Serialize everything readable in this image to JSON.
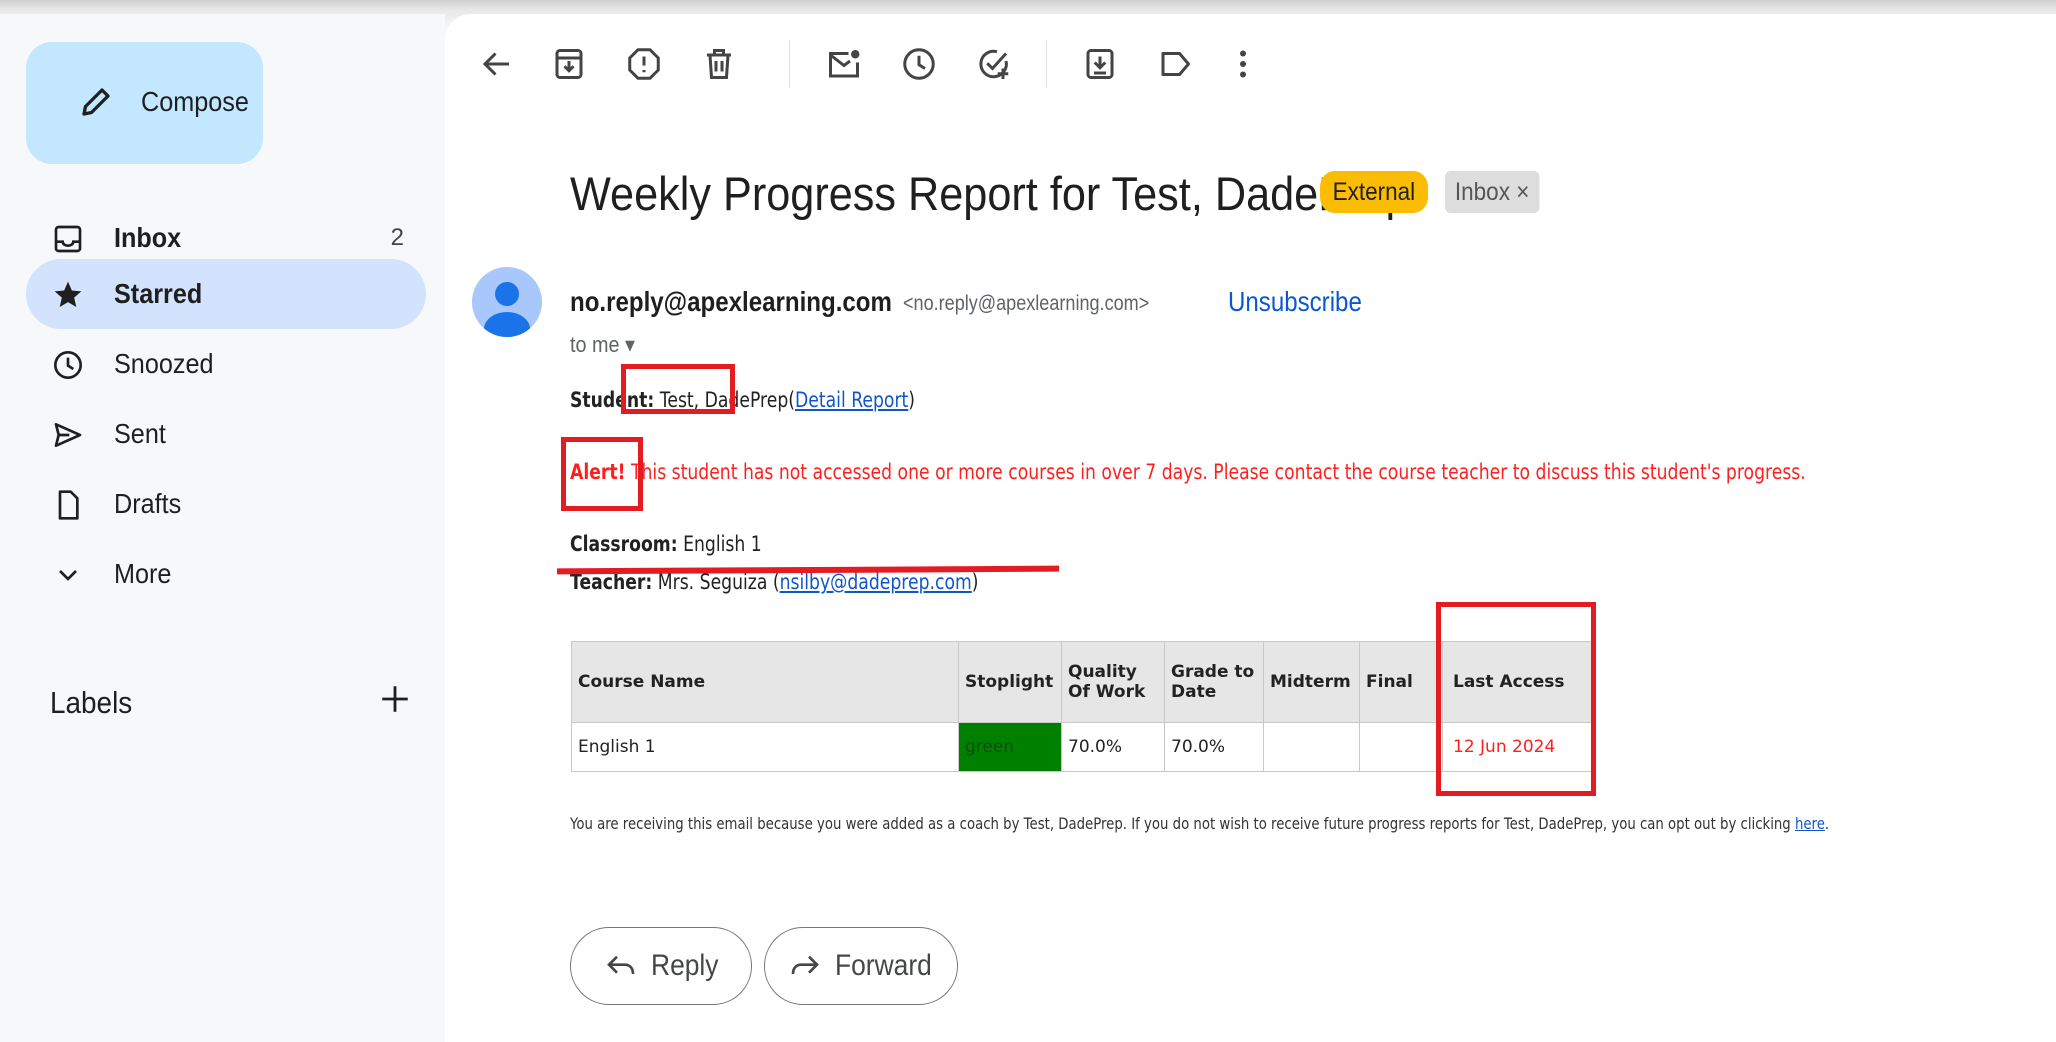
{
  "compose": {
    "label": "Compose"
  },
  "nav": [
    {
      "label": "Inbox",
      "count": "2",
      "icon": "inbox-icon"
    },
    {
      "label": "Starred",
      "count": "",
      "icon": "star-icon"
    },
    {
      "label": "Snoozed",
      "count": "",
      "icon": "clock-icon"
    },
    {
      "label": "Sent",
      "count": "",
      "icon": "send-icon"
    },
    {
      "label": "Drafts",
      "count": "",
      "icon": "draft-icon"
    },
    {
      "label": "More",
      "count": "",
      "icon": "chevron-down-icon"
    }
  ],
  "labels": {
    "header": "Labels"
  },
  "toolbar": {
    "icons": [
      "back-arrow-icon",
      "archive-icon",
      "report-spam-icon",
      "delete-icon",
      "mark-unread-icon",
      "snooze-icon",
      "add-to-tasks-icon",
      "move-to-icon",
      "label-icon",
      "more-vert-icon"
    ]
  },
  "email": {
    "subject": "Weekly Progress Report for Test, DadePrep",
    "badge_external": "External",
    "badge_inbox": "Inbox ×",
    "sender_name": "no.reply@apexlearning.com",
    "sender_email": "<no.reply@apexlearning.com>",
    "unsubscribe": "Unsubscribe",
    "to": "to me ▾",
    "student_label": "Student:",
    "student_value": "Test, DadePrep",
    "detail_open": "(",
    "detail_link": "Detail Report",
    "detail_close": ")",
    "alert_label": "Alert!",
    "alert_text": "This student has not accessed one or more courses in over 7 days. Please contact the course teacher to discuss this student's progress.",
    "classroom_label": "Classroom:",
    "classroom_value": "English 1",
    "teacher_label": "Teacher:",
    "teacher_value": "Mrs. Seguiza (",
    "teacher_email": "nsilby@dadeprep.com",
    "teacher_close": ")",
    "table": {
      "headers": [
        "Course Name",
        "Stoplight",
        "Quality Of Work",
        "Grade to Date",
        "Midterm",
        "Final",
        "Last Access"
      ],
      "row": [
        "English 1",
        "green",
        "70.0%",
        "70.0%",
        "",
        "",
        "12 Jun 2024"
      ]
    },
    "footer_text": "You are receiving this email because you were added as a coach by Test, DadePrep. If you do not wish to receive future progress reports for Test, DadePrep, you can opt out by clicking ",
    "footer_link": "here",
    "footer_end": "."
  },
  "actions": {
    "reply": "Reply",
    "forward": "Forward"
  },
  "colors": {
    "compose_bg": "#c2e7ff",
    "active_nav": "#d3e3fd",
    "external_badge": "#fbbc04",
    "alert_red": "#ff1f1f",
    "annotation_red": "#e31b23",
    "stoplight_green": "#008000",
    "link_blue": "#0b57d0"
  }
}
